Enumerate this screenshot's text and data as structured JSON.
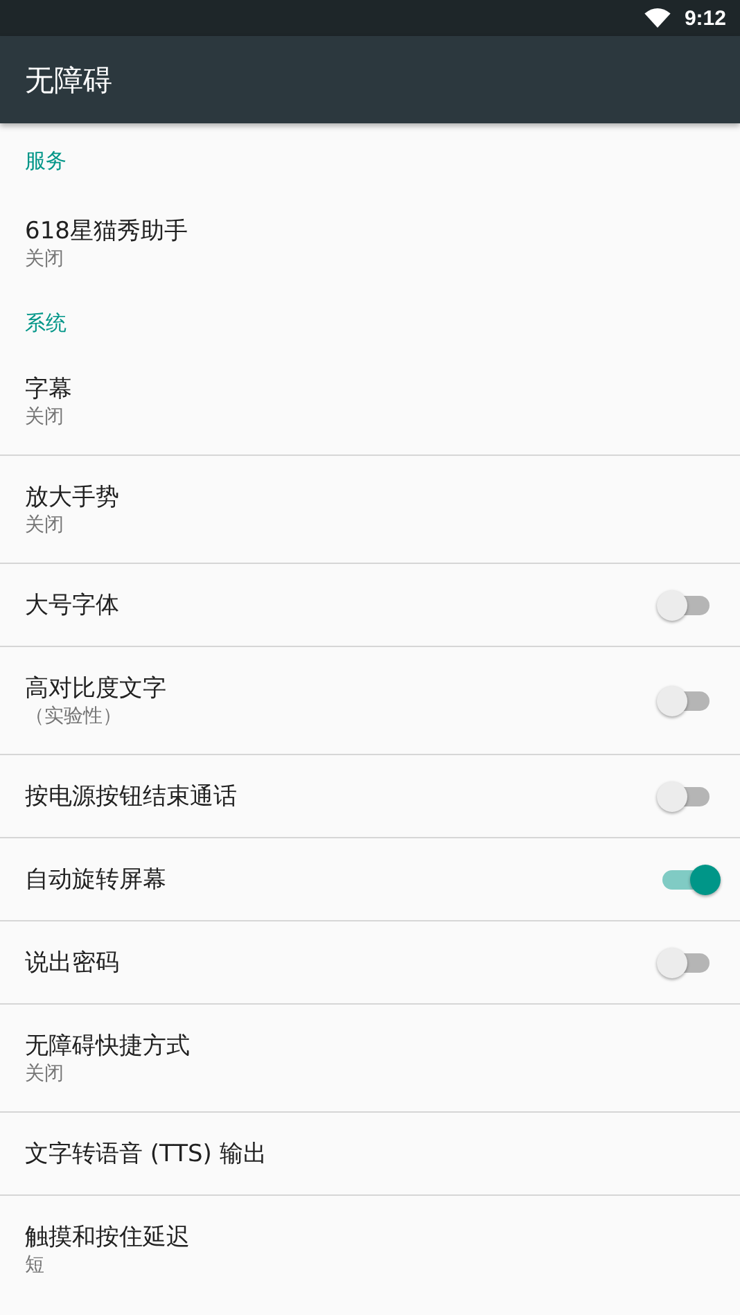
{
  "status_bar": {
    "time": "9:12"
  },
  "toolbar": {
    "title": "无障碍"
  },
  "sections": [
    {
      "title": "服务",
      "items": [
        {
          "kind": "text",
          "title": "618星猫秀助手",
          "summary": "关闭"
        }
      ]
    },
    {
      "title": "系统",
      "items": [
        {
          "kind": "text",
          "title": "字幕",
          "summary": "关闭"
        },
        {
          "kind": "text",
          "title": "放大手势",
          "summary": "关闭"
        },
        {
          "kind": "switch",
          "title": "大号字体",
          "on": false
        },
        {
          "kind": "switch",
          "title": "高对比度文字",
          "summary": "（实验性）",
          "on": false
        },
        {
          "kind": "switch",
          "title": "按电源按钮结束通话",
          "on": false
        },
        {
          "kind": "switch",
          "title": "自动旋转屏幕",
          "on": true
        },
        {
          "kind": "switch",
          "title": "说出密码",
          "on": false
        },
        {
          "kind": "text",
          "title": "无障碍快捷方式",
          "summary": "关闭"
        },
        {
          "kind": "text",
          "title": "文字转语音 (TTS) 输出"
        },
        {
          "kind": "text",
          "title": "触摸和按住延迟",
          "summary": "短"
        }
      ]
    }
  ]
}
